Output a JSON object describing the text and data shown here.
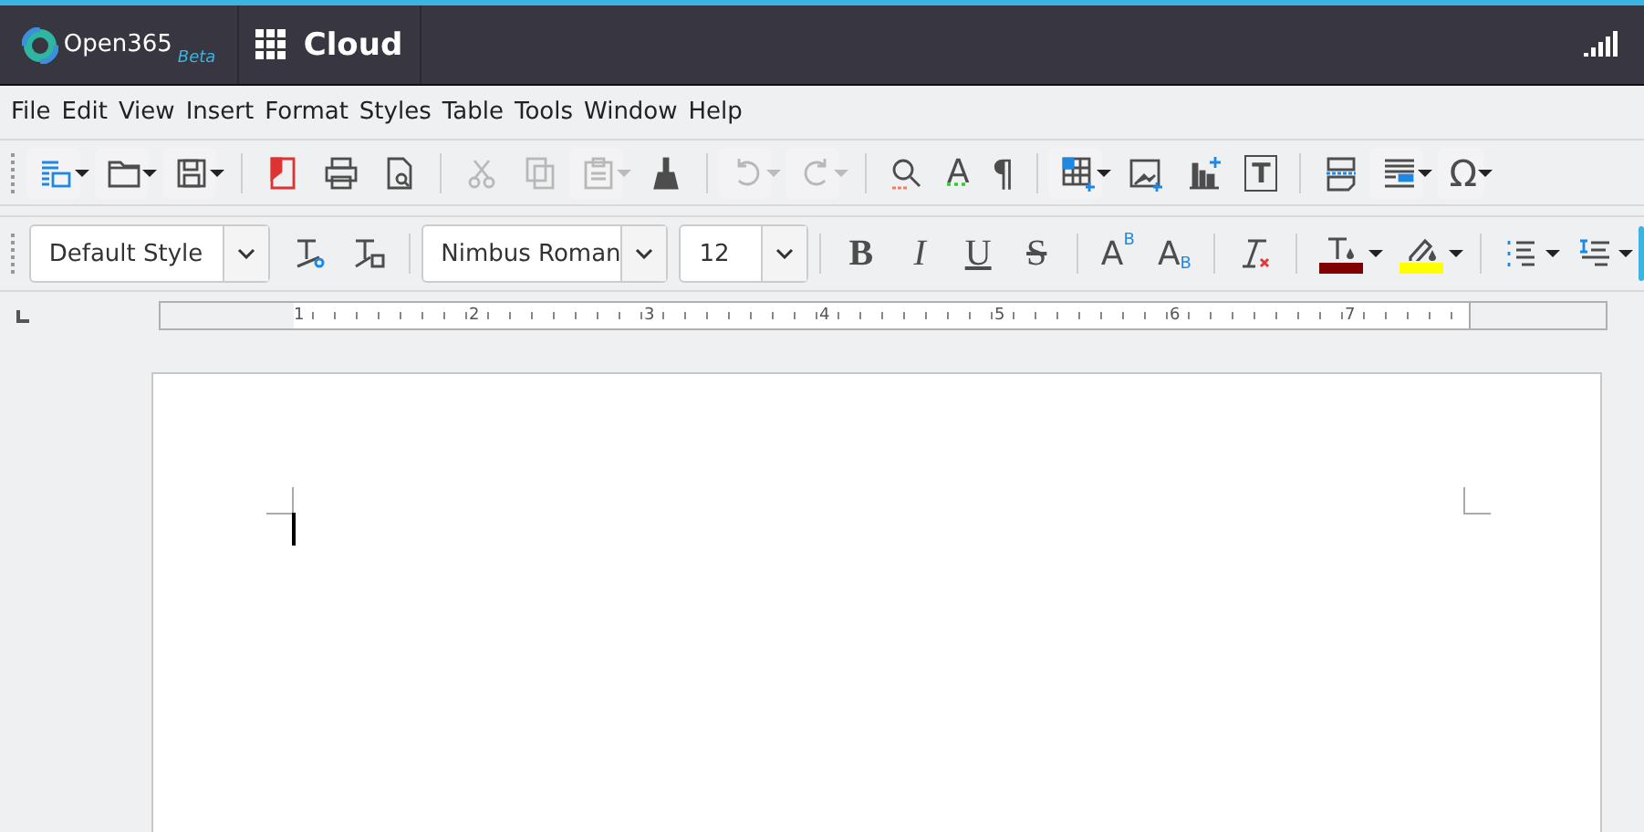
{
  "app_bar": {
    "logo_text": "Open365",
    "logo_badge": "Beta",
    "cloud_label": "Cloud"
  },
  "menu": [
    "File",
    "Edit",
    "View",
    "Insert",
    "Format",
    "Styles",
    "Table",
    "Tools",
    "Window",
    "Help"
  ],
  "toolbar_groups": [
    [
      {
        "kind": "new",
        "dropdown": true,
        "disabled": false
      },
      {
        "kind": "open",
        "dropdown": true,
        "disabled": false
      },
      {
        "kind": "save",
        "dropdown": true,
        "disabled": false
      }
    ],
    [
      {
        "kind": "pdf",
        "dropdown": false,
        "disabled": false
      },
      {
        "kind": "print",
        "dropdown": false,
        "disabled": false
      },
      {
        "kind": "preview",
        "dropdown": false,
        "disabled": false
      }
    ],
    [
      {
        "kind": "cut",
        "dropdown": false,
        "disabled": true
      },
      {
        "kind": "copy",
        "dropdown": false,
        "disabled": true
      },
      {
        "kind": "paste",
        "dropdown": true,
        "disabled": true
      },
      {
        "kind": "brush",
        "dropdown": false,
        "disabled": false
      }
    ],
    [
      {
        "kind": "undo",
        "dropdown": true,
        "disabled": true
      },
      {
        "kind": "redo",
        "dropdown": true,
        "disabled": true
      }
    ],
    [
      {
        "kind": "find",
        "dropdown": false,
        "disabled": false
      },
      {
        "kind": "spelling",
        "glyph": "A",
        "dropdown": false,
        "disabled": false
      },
      {
        "kind": "marks",
        "glyph": "¶",
        "dropdown": false,
        "disabled": false
      }
    ],
    [
      {
        "kind": "table",
        "dropdown": true,
        "disabled": false
      },
      {
        "kind": "image",
        "dropdown": false,
        "disabled": false
      },
      {
        "kind": "chart",
        "dropdown": false,
        "disabled": false
      },
      {
        "kind": "textbox",
        "glyph": "T",
        "dropdown": false,
        "disabled": false
      }
    ],
    [
      {
        "kind": "pagebreak",
        "dropdown": false,
        "disabled": false
      },
      {
        "kind": "field",
        "dropdown": true,
        "disabled": false
      },
      {
        "kind": "special",
        "glyph": "Ω",
        "dropdown": true,
        "disabled": false
      }
    ]
  ],
  "paragraph_style": {
    "value": "Default Style"
  },
  "font_name": {
    "value": "Nimbus Roman"
  },
  "font_size": {
    "value": "12"
  },
  "format_groups": [
    [
      {
        "kind": "bold",
        "glyph": "B",
        "dropdown": false
      },
      {
        "kind": "italic",
        "glyph": "I",
        "dropdown": false
      },
      {
        "kind": "underline",
        "glyph": "U",
        "dropdown": false
      },
      {
        "kind": "strike",
        "glyph": "S",
        "dropdown": false
      }
    ],
    [
      {
        "kind": "superscript",
        "glyph": "A",
        "small_glyph": "B",
        "dropdown": false
      },
      {
        "kind": "subscript",
        "glyph": "A",
        "small_glyph": "B",
        "dropdown": false
      }
    ],
    [
      {
        "kind": "clear",
        "dropdown": false
      }
    ],
    [
      {
        "kind": "fontcolor",
        "color": "#800000",
        "dropdown": true
      },
      {
        "kind": "highlight",
        "color": "#ffff00",
        "dropdown": true
      }
    ],
    [
      {
        "kind": "list",
        "dropdown": true
      },
      {
        "kind": "spacing",
        "dropdown": true
      }
    ]
  ],
  "ruler": {
    "labels": [
      "1",
      "2",
      "3",
      "4",
      "5",
      "6",
      "7"
    ]
  }
}
